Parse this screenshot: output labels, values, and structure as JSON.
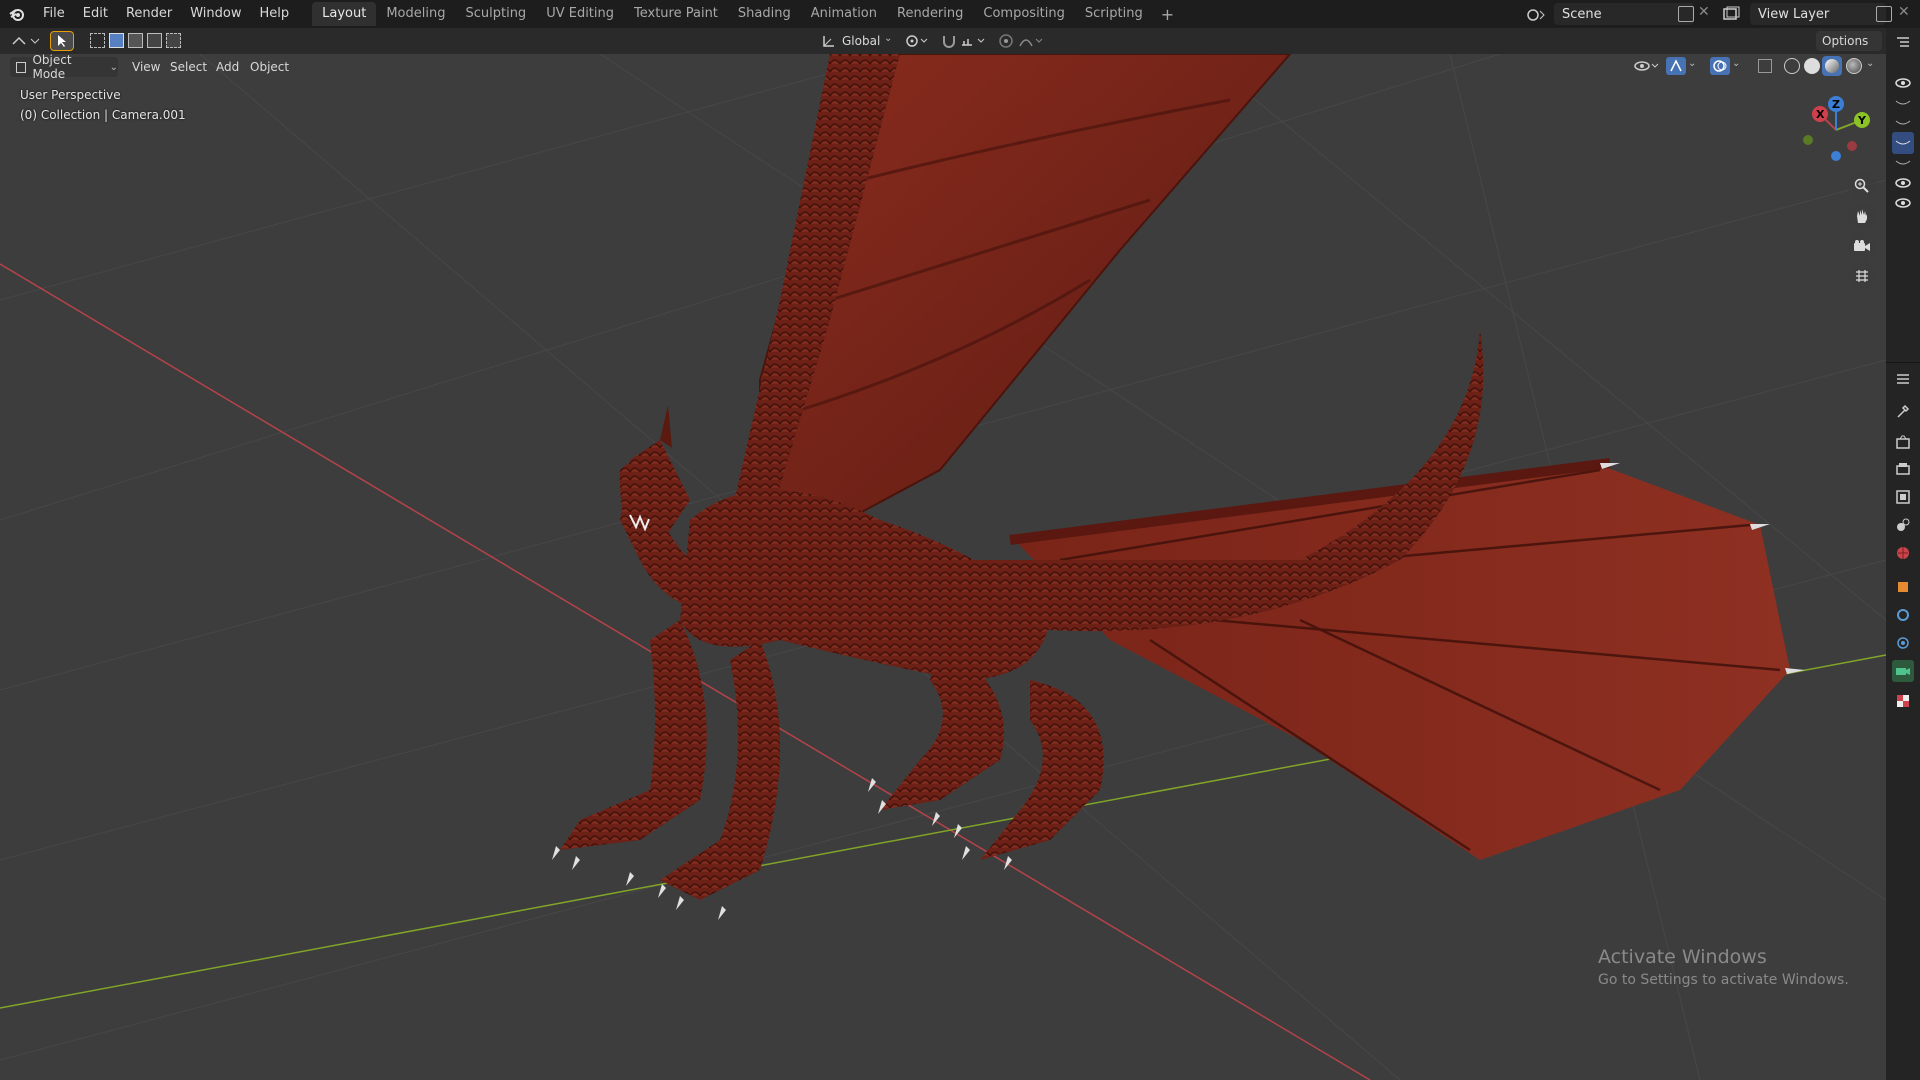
{
  "app": {
    "name": "Blender"
  },
  "menu": [
    "File",
    "Edit",
    "Render",
    "Window",
    "Help"
  ],
  "workspaces": [
    "Layout",
    "Modeling",
    "Sculpting",
    "UV Editing",
    "Texture Paint",
    "Shading",
    "Animation",
    "Rendering",
    "Compositing",
    "Scripting"
  ],
  "workspace_add": "+",
  "scene": {
    "label": "Scene"
  },
  "view_layer": {
    "label": "View Layer"
  },
  "tool_header": {
    "transform_orientation": "Global",
    "options_label": "Options"
  },
  "viewport_header": {
    "mode": "Object Mode",
    "menus": [
      "View",
      "Select",
      "Add",
      "Object"
    ]
  },
  "viewport": {
    "perspective_label": "User Perspective",
    "collection_label": "(0) Collection | Camera.001",
    "gizmo": {
      "x": "X",
      "y": "Y",
      "z": "Z"
    }
  },
  "watermark": {
    "title": "Activate Windows",
    "subtitle": "Go to Settings to activate Windows."
  },
  "colors": {
    "x_axis": "#b5434a",
    "y_axis": "#82a528",
    "z_axis": "#3b7fd6",
    "viewport_bg": "#3d3d3d",
    "dragon": "#7a2418"
  }
}
